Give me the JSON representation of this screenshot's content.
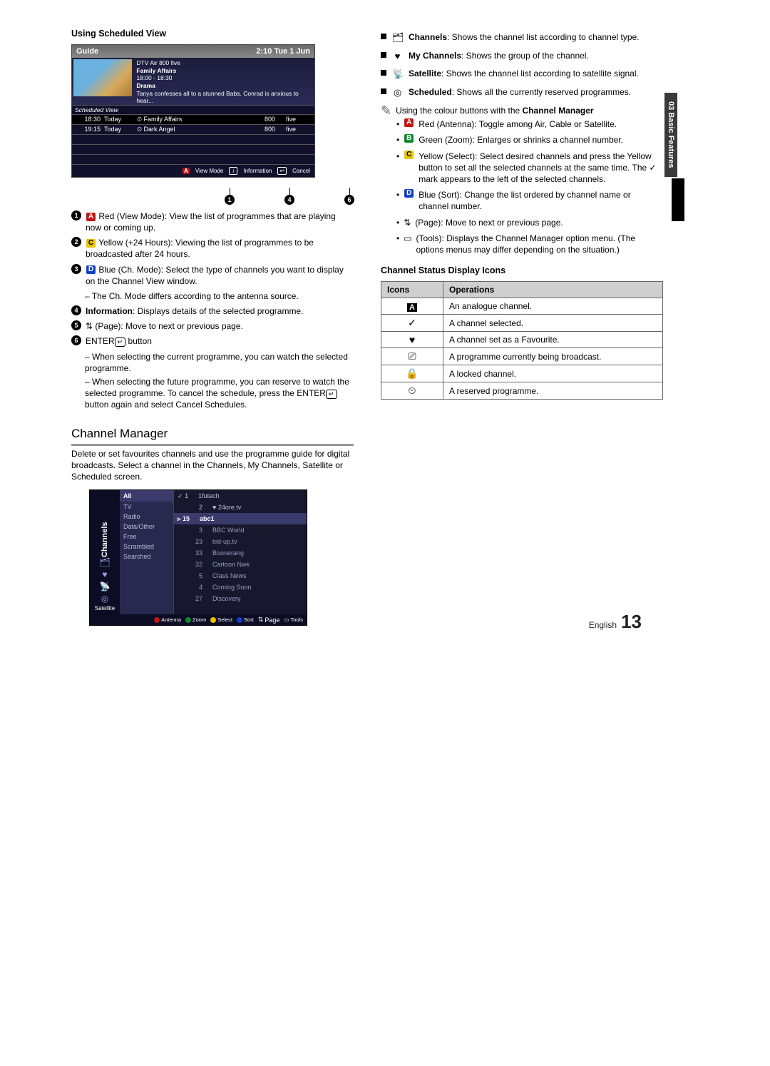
{
  "page_tab": "03  Basic Features",
  "left": {
    "using_scheduled": "Using Scheduled View",
    "guide": {
      "title": "Guide",
      "clock": "2:10 Tue 1 Jun",
      "meta_line1": "DTV Air 800 five",
      "meta_line2": "Family Affairs",
      "meta_line3": "18:00 - 18:30",
      "meta_line4": "Drama",
      "meta_desc": "Tanya confesses all to a stunned Babs. Conrad is anxious to hear...",
      "sub": "Scheduled View",
      "rows": [
        {
          "t": "18:30",
          "d": "Today",
          "title": "Family Affairs",
          "num": "800",
          "ch": "five"
        },
        {
          "t": "19:15",
          "d": "Today",
          "title": "Dark Angel",
          "num": "800",
          "ch": "five"
        }
      ],
      "foot_view": "View Mode",
      "foot_info": "Information",
      "foot_cancel": "Cancel"
    },
    "callout_1": "1",
    "callout_4": "4",
    "callout_6": "6",
    "items": {
      "i1": " Red (View Mode): View the list of programmes that are playing now or coming up.",
      "i2": " Yellow (+24 Hours): Viewing the list of programmes to be broadcasted after 24 hours.",
      "i3": " Blue (Ch. Mode): Select the type of channels you want to display on the Channel View window.",
      "i3s": "The Ch. Mode differs according to the antenna source.",
      "i4": "Information: Displays details of the selected programme.",
      "i5": " (Page): Move to next or previous page.",
      "i6_lead": "ENTER",
      "i6_tail": " button",
      "i6a": "When selecting the current programme, you can watch the selected programme.",
      "i6b": "When selecting the future programme, you can reserve to watch the selected programme. To cancel the schedule, press the ENTER",
      "i6b2": " button again and select Cancel Schedules."
    },
    "section": "Channel Manager",
    "cm_para": "Delete or set favourites channels and use the programme guide for digital broadcasts. Select a channel in the Channels, My Channels, Satellite or Scheduled screen.",
    "cm": {
      "side_label": "Channels",
      "satellite": "Satellite",
      "cat_head": "All",
      "cats": [
        "TV",
        "Radio",
        "Data/Other",
        "Free",
        "Scrambled",
        "Searched"
      ],
      "top": [
        {
          "n": "1",
          "c": "1futech",
          "mark": "✓"
        },
        {
          "n": "2",
          "c": "24ore.tv",
          "mark": "♥"
        }
      ],
      "sel_n": "15",
      "sel_c": "abc1",
      "list": [
        {
          "n": "3",
          "c": "BBC World"
        },
        {
          "n": "23",
          "c": "bid-up.tv"
        },
        {
          "n": "33",
          "c": "Boonerang"
        },
        {
          "n": "32",
          "c": "Cartoon Nwk"
        },
        {
          "n": "5",
          "c": "Class News"
        },
        {
          "n": "4",
          "c": "Coming Soon"
        },
        {
          "n": "27",
          "c": "Discovery"
        }
      ],
      "foot": [
        "Antenna",
        "Zoom",
        "Select",
        "Sort",
        "Page",
        "Tools"
      ]
    }
  },
  "right": {
    "opts": [
      {
        "icon": "🗂",
        "bold": "Channels",
        "txt": ": Shows the channel list according to channel type."
      },
      {
        "icon": "♥",
        "bold": "My Channels",
        "txt": ": Shows the group of the channel."
      },
      {
        "icon": "📡",
        "bold": "Satellite",
        "txt": ": Shows the channel list according to satellite signal."
      },
      {
        "icon": "◎",
        "bold": "Scheduled",
        "txt": ": Shows all the currently reserved programmes."
      }
    ],
    "tip": "Using the colour buttons with the Channel Manager",
    "colours": [
      {
        "cls": "red",
        "let": "A",
        "txt": " Red (Antenna): Toggle among Air, Cable or Satellite."
      },
      {
        "cls": "green",
        "let": "B",
        "txt": " Green (Zoom): Enlarges or shrinks a channel number."
      },
      {
        "cls": "yellow",
        "let": "C",
        "txt": " Yellow (Select): Select desired channels and press the Yellow button to set all the selected channels at the same time. The ✓ mark appears to the left of the selected channels."
      },
      {
        "cls": "blue",
        "let": "D",
        "txt": " Blue (Sort): Change the list ordered by channel name or channel number."
      },
      {
        "cls": "",
        "let": "⇅",
        "txt": " (Page): Move to next or previous page."
      },
      {
        "cls": "",
        "let": "▭",
        "txt": " (Tools): Displays the Channel Manager option menu. (The options menus may differ depending on the situation.)"
      }
    ],
    "stat_head": "Channel Status Display Icons",
    "th_icons": "Icons",
    "th_ops": "Operations",
    "rows": [
      {
        "i": "A",
        "t": "An analogue channel."
      },
      {
        "i": "✓",
        "t": "A channel selected."
      },
      {
        "i": "♥",
        "t": "A channel set as a Favourite."
      },
      {
        "i": "⎚",
        "t": "A programme currently being broadcast."
      },
      {
        "i": "🔒",
        "t": "A locked channel."
      },
      {
        "i": "⏲",
        "t": "A reserved programme."
      }
    ]
  },
  "footer_lang": "English",
  "footer_num": "13"
}
